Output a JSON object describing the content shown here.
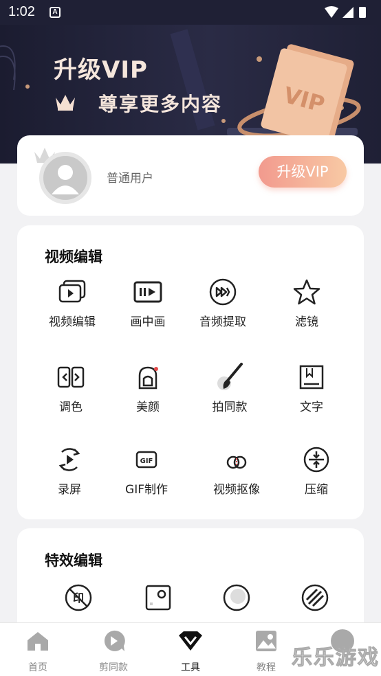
{
  "status_bar": {
    "time": "1:02",
    "notif": "A"
  },
  "banner": {
    "title": "升级VIP",
    "subtitle": "尊享更多内容",
    "card_text": "VIP"
  },
  "user": {
    "name": "普通用户",
    "upgrade_label": "升级VIP"
  },
  "video_edit": {
    "title": "视频编辑",
    "tools": [
      {
        "label": "视频编辑",
        "icon": "video-stack-icon"
      },
      {
        "label": "画中画",
        "icon": "picture-in-picture-icon"
      },
      {
        "label": "音频提取",
        "icon": "audio-extract-icon"
      },
      {
        "label": "滤镜",
        "icon": "star-icon"
      },
      {
        "label": "调色",
        "icon": "color-adjust-icon"
      },
      {
        "label": "美颜",
        "icon": "beauty-icon"
      },
      {
        "label": "拍同款",
        "icon": "brush-icon"
      },
      {
        "label": "文字",
        "icon": "text-icon"
      },
      {
        "label": "录屏",
        "icon": "screen-record-icon"
      },
      {
        "label": "GIF制作",
        "icon": "gif-icon",
        "badge": "GIF"
      },
      {
        "label": "视频抠像",
        "icon": "matting-icon"
      },
      {
        "label": "压缩",
        "icon": "compress-icon"
      }
    ]
  },
  "fx_edit": {
    "title": "特效编辑",
    "tools": [
      {
        "icon": "watermark-remove-icon",
        "glyph": "印"
      },
      {
        "icon": "photo-frame-icon"
      },
      {
        "icon": "circle-mask-icon"
      },
      {
        "icon": "stripe-effect-icon"
      }
    ]
  },
  "nav": [
    {
      "label": "首页",
      "icon": "home-icon"
    },
    {
      "label": "剪同款",
      "icon": "play-bubble-icon"
    },
    {
      "label": "工具",
      "icon": "diamond-icon",
      "active": true
    },
    {
      "label": "教程",
      "icon": "image-icon"
    },
    {
      "label": "",
      "icon": "profile-icon"
    }
  ],
  "watermark": "乐乐游戏",
  "colors": {
    "banner_bg": "#1f2035",
    "gold": "#f5e6dc",
    "upgrade_start": "#f29a8e",
    "upgrade_end": "#f8c9a4"
  }
}
